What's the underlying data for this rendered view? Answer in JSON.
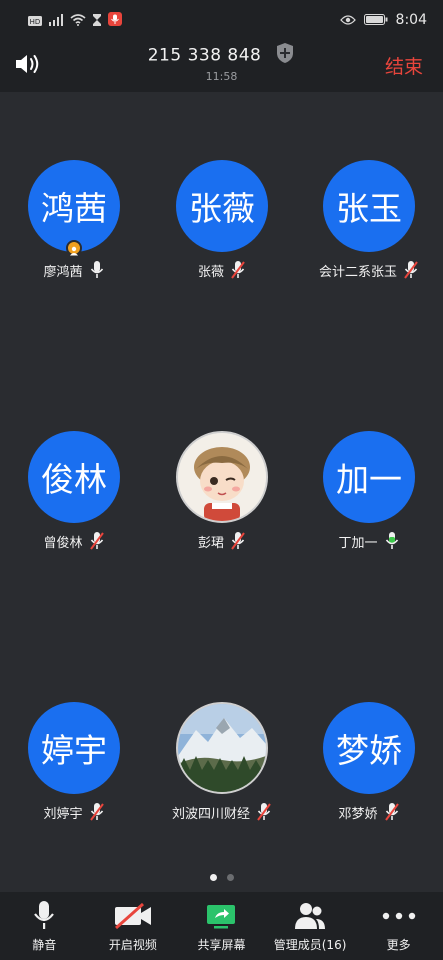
{
  "status_bar": {
    "time": "8:04",
    "network_label": "HD"
  },
  "header": {
    "meeting_id": "215 338 848",
    "elapsed": "11:58",
    "end_label": "结束"
  },
  "participants": [
    {
      "avatar_text": "鸿茜",
      "name": "廖鸿茜",
      "mic": "on",
      "host": true
    },
    {
      "avatar_text": "张薇",
      "name": "张薇",
      "mic": "muted"
    },
    {
      "avatar_text": "张玉",
      "name": "会计二系张玉",
      "mic": "muted"
    },
    {
      "avatar_text": "俊林",
      "name": "曾俊林",
      "mic": "muted"
    },
    {
      "avatar_text": "",
      "name": "彭珺",
      "mic": "muted",
      "photo": "cartoon-avatar"
    },
    {
      "avatar_text": "加一",
      "name": "丁加一",
      "mic": "speaking"
    },
    {
      "avatar_text": "婷宇",
      "name": "刘婷宇",
      "mic": "muted"
    },
    {
      "avatar_text": "",
      "name": "刘波四川财经",
      "mic": "muted",
      "photo": "mountain-photo"
    },
    {
      "avatar_text": "梦娇",
      "name": "邓梦娇",
      "mic": "muted"
    }
  ],
  "pagination": {
    "current_page": 1,
    "total_pages": 2
  },
  "toolbar": {
    "mute_label": "静音",
    "video_label": "开启视频",
    "share_label": "共享屏幕",
    "members_label": "管理成员(16)",
    "more_label": "更多"
  },
  "colors": {
    "avatar_blue": "#1a6ff0",
    "end_red": "#e8453c",
    "mic_muted_red": "#e8453c",
    "mic_speaking_green": "#3cc84a",
    "share_green": "#2bc36b",
    "host_badge": "#f0a020"
  }
}
